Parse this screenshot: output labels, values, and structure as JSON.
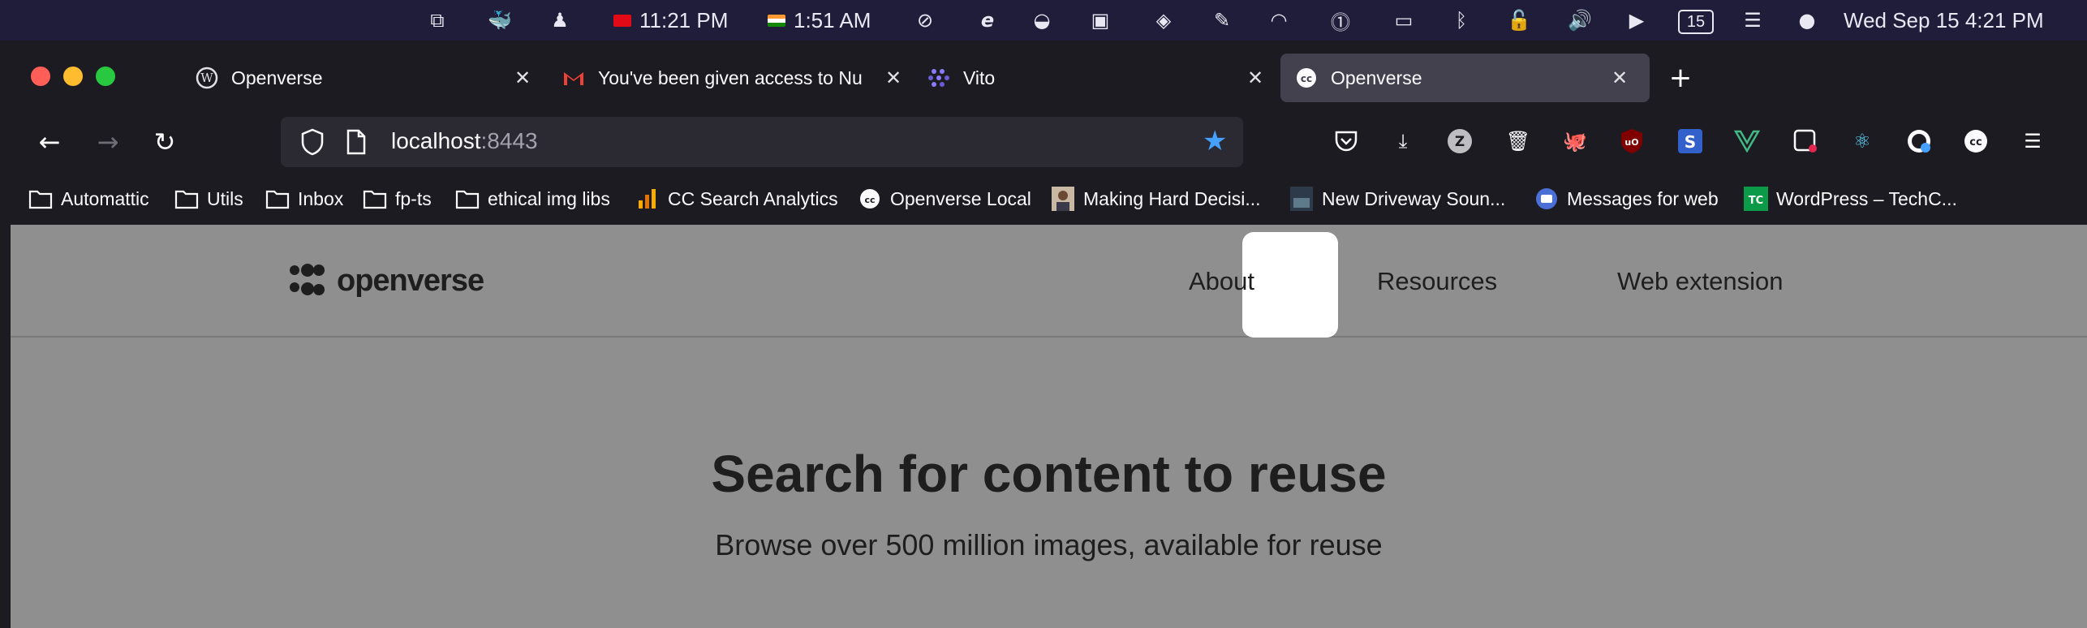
{
  "menubar": {
    "clock_tr": "11:21 PM",
    "clock_in": "1:51 AM",
    "calendar_day": "15",
    "datetime": "Wed Sep 15  4:21 PM"
  },
  "tabs": [
    {
      "title": "Openverse"
    },
    {
      "title": "You've been given access to Nu"
    },
    {
      "title": "Vito"
    },
    {
      "title": "Openverse"
    }
  ],
  "url": {
    "host": "localhost",
    "port": ":8443"
  },
  "bookmarks": [
    {
      "label": "Automattic"
    },
    {
      "label": "Utils"
    },
    {
      "label": "Inbox"
    },
    {
      "label": "fp-ts"
    },
    {
      "label": "ethical img libs"
    },
    {
      "label": "CC Search Analytics"
    },
    {
      "label": "Openverse Local"
    },
    {
      "label": "Making Hard Decisi..."
    },
    {
      "label": "New Driveway Soun..."
    },
    {
      "label": "Messages for web"
    },
    {
      "label": "WordPress – TechC..."
    }
  ],
  "site": {
    "logo_text": "openverse",
    "nav": [
      "About",
      "Resources",
      "Web extension"
    ],
    "hero_title": "Search for content to reuse",
    "hero_subtitle": "Browse over 500 million images, available for reuse"
  },
  "colors": {
    "accent_star": "#45a1ff",
    "page_overlay": "#8f8f8f",
    "menubar_bg": "#201d3a"
  }
}
